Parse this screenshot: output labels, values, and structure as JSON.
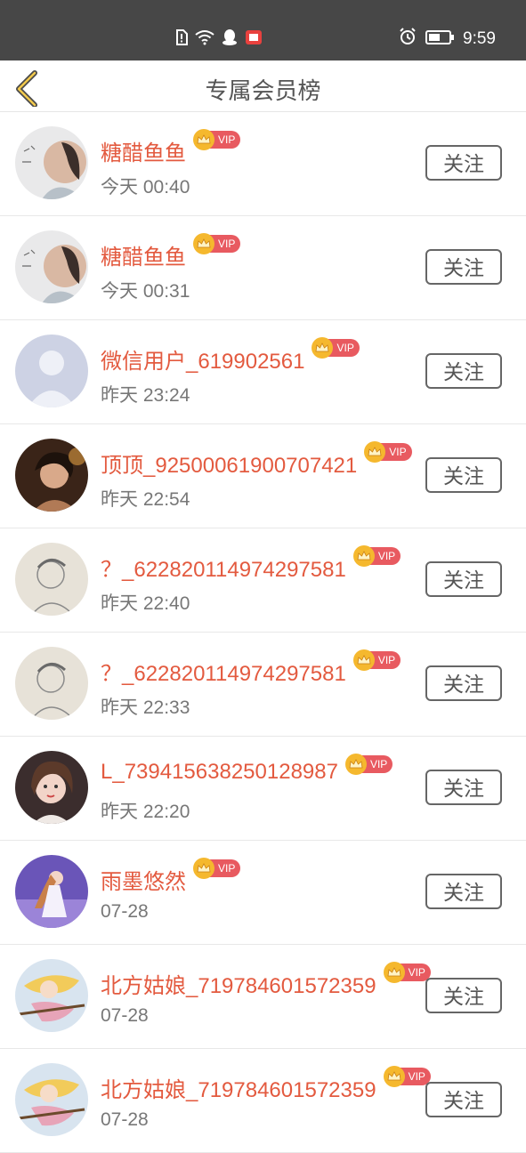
{
  "status_bar": {
    "time": "9:59",
    "icons": [
      "sim-alert-icon",
      "wifi-icon",
      "qq-icon",
      "app-notify-icon",
      "alarm-icon",
      "battery-icon"
    ]
  },
  "header": {
    "title": "专属会员榜",
    "back_icon": "chevron-left-icon"
  },
  "vip_label": "VIP",
  "follow_label": "关注",
  "colors": {
    "name": "#e35a3f",
    "vip_badge": "#e85a60",
    "crown": "#f5b82e",
    "time": "#777777"
  },
  "members": [
    {
      "name": "糖醋鱼鱼",
      "time": "今天 00:40",
      "avatar": "girl-photo-avatar"
    },
    {
      "name": "糖醋鱼鱼",
      "time": "今天 00:31",
      "avatar": "girl-photo-avatar"
    },
    {
      "name": "微信用户_619902561",
      "time": "昨天 23:24",
      "avatar": "default-user-avatar"
    },
    {
      "name": "顶顶_92500061900707421",
      "time": "昨天 22:54",
      "avatar": "woman-portrait-avatar"
    },
    {
      "name": "？_622820114974297581",
      "time": "昨天 22:40",
      "avatar": "sketch-man-avatar"
    },
    {
      "name": "？_622820114974297581",
      "time": "昨天 22:33",
      "avatar": "sketch-man-avatar"
    },
    {
      "name": "L_739415638250128987",
      "time": "昨天 22:20",
      "avatar": "selfie-avatar"
    },
    {
      "name": "雨墨悠然",
      "time": "07-28",
      "avatar": "purple-art-avatar"
    },
    {
      "name": "北方姑娘_719784601572359",
      "time": "07-28",
      "avatar": "anime-witch-avatar"
    },
    {
      "name": "北方姑娘_719784601572359",
      "time": "07-28",
      "avatar": "anime-witch-avatar"
    }
  ]
}
